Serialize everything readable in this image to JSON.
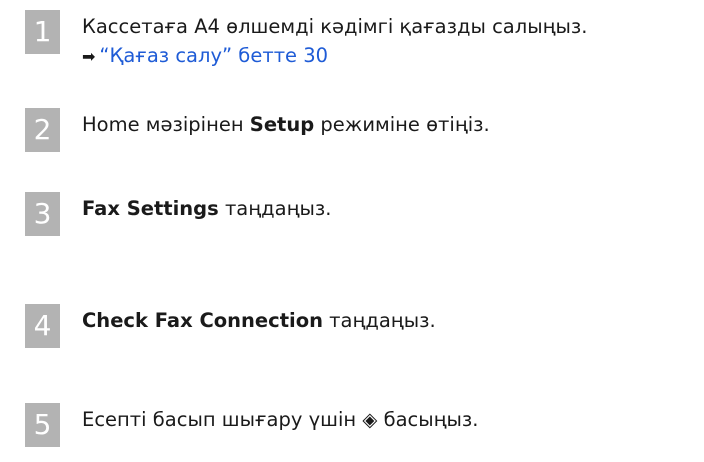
{
  "steps": [
    {
      "number": "1",
      "line1": "Кассетаға A4 өлшемді кәдімгі қағазды салыңыз.",
      "link": "“Қағаз салу” бетте 30"
    },
    {
      "number": "2",
      "pre": "Home мәзірінен ",
      "bold": "Setup",
      "post": " режиміне өтіңіз."
    },
    {
      "number": "3",
      "bold": "Fax Settings",
      "post": " таңдаңыз."
    },
    {
      "number": "4",
      "bold": "Check Fax Connection",
      "post": " таңдаңыз."
    },
    {
      "number": "5",
      "text": "Есепті басып шығару үшін ◈ басыңыз."
    }
  ]
}
